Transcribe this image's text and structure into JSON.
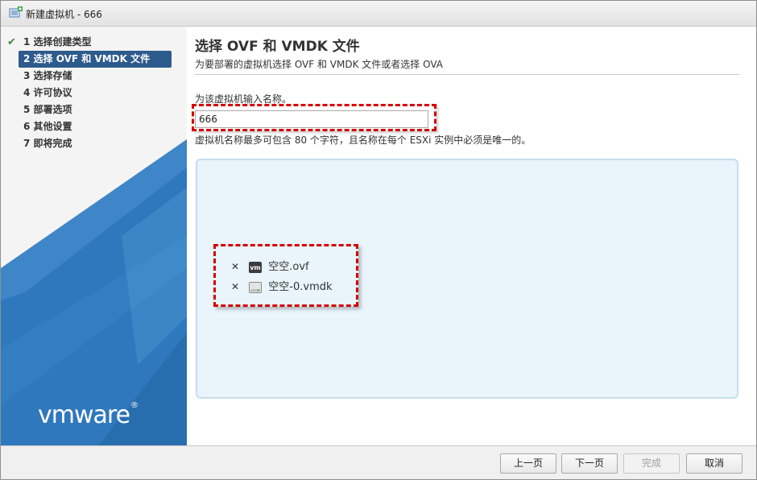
{
  "window": {
    "title": "新建虚拟机 - 666"
  },
  "sidebar": {
    "steps": [
      {
        "label": "1 选择创建类型",
        "completed": true
      },
      {
        "label": "2 选择 OVF 和 VMDK 文件",
        "active": true
      },
      {
        "label": "3 选择存储"
      },
      {
        "label": "4 许可协议"
      },
      {
        "label": "5 部署选项"
      },
      {
        "label": "6 其他设置"
      },
      {
        "label": "7 即将完成"
      }
    ],
    "logo": "vmware"
  },
  "main": {
    "title": "选择 OVF 和 VMDK 文件",
    "subtitle": "为要部署的虚拟机选择 OVF 和 VMDK 文件或者选择 OVA",
    "name_label": "为该虚拟机输入名称。",
    "name_value": "666",
    "help_text": "虚拟机名称最多可包含 80 个字符，且名称在每个 ESXi 实例中必须是唯一的。",
    "files": [
      {
        "name": "空空.ovf",
        "icon": "vm-icon"
      },
      {
        "name": "空空-0.vmdk",
        "icon": "disk-icon"
      }
    ],
    "remove_glyph": "✕"
  },
  "footer": {
    "back_label": "上一页",
    "next_label": "下一页",
    "finish_label": "完成",
    "cancel_label": "取消"
  },
  "colors": {
    "accent": "#2e5b8d",
    "highlight": "#d40000",
    "dropzone_bg": "#e9f4fb",
    "sidebar_blue": "#2f78bd"
  }
}
